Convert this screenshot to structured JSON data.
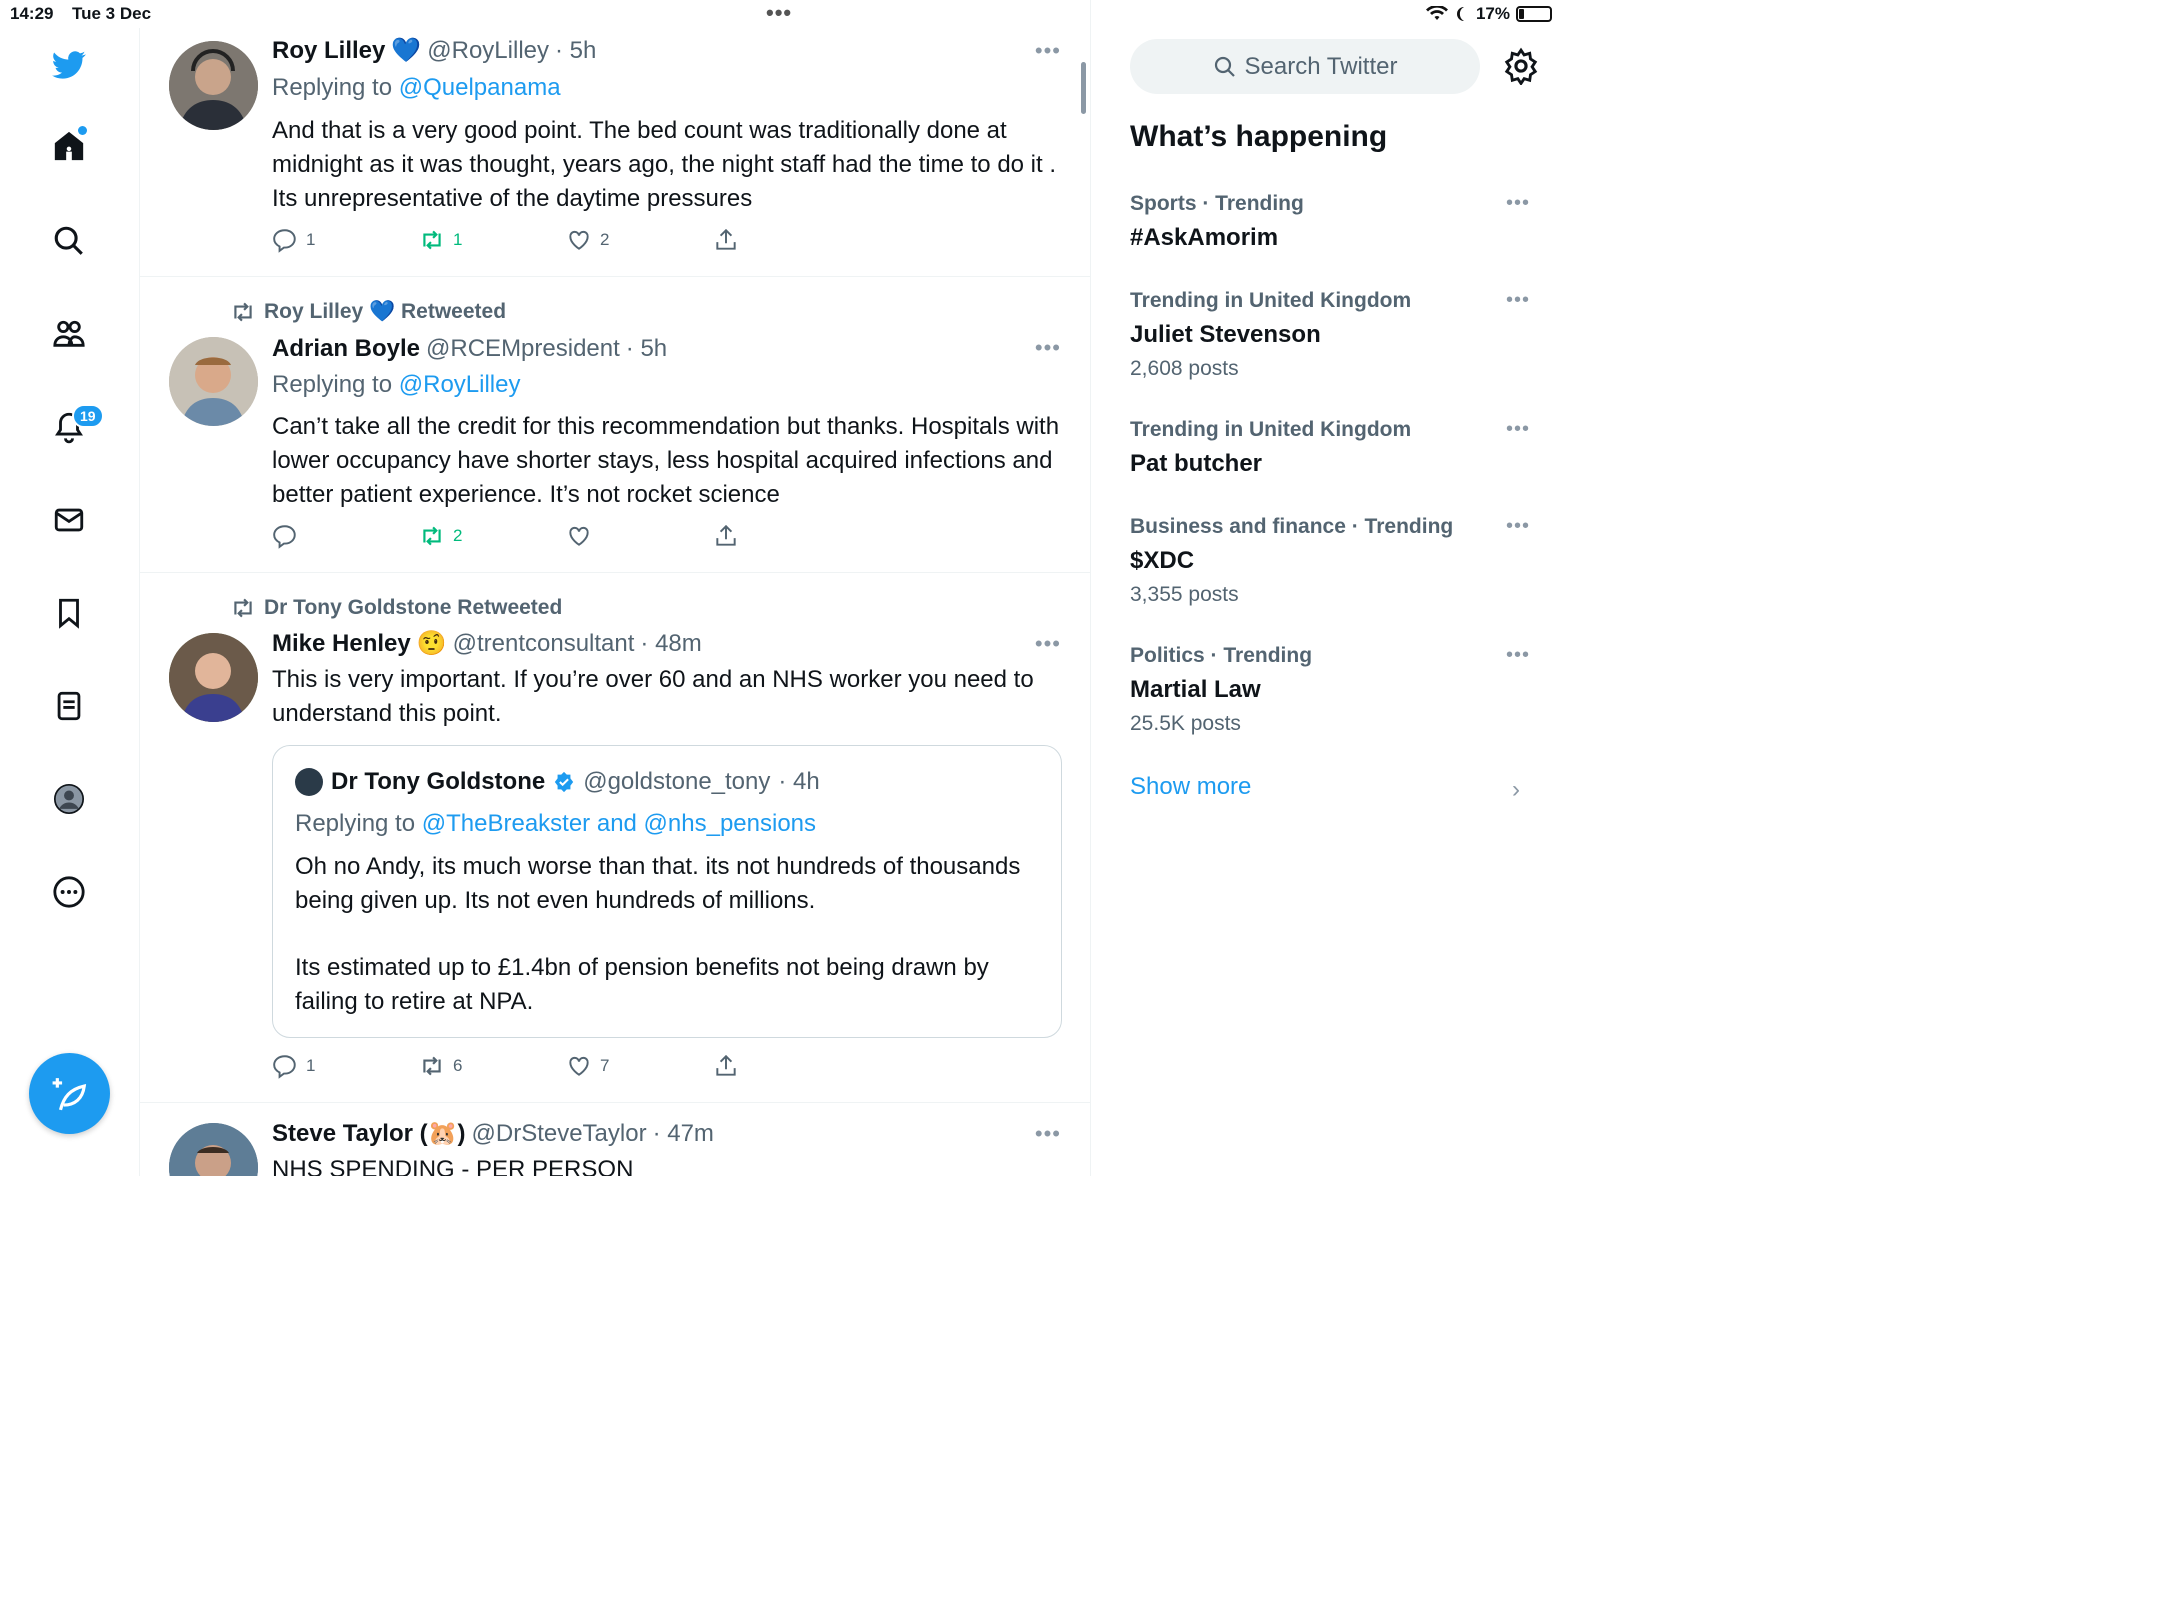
{
  "status_bar": {
    "time": "14:29",
    "date": "Tue 3 Dec",
    "battery": "17%",
    "battery_level": 0.17
  },
  "sidebar": {
    "notifications_count": "19"
  },
  "tweets": [
    {
      "name": "Roy Lilley",
      "emoji": "💙",
      "handle": "@RoyLilley",
      "time": "· 5h",
      "reply_prefix": "Replying to",
      "reply_to": "@Quelpanama",
      "body": "And that is a very good point. The bed count was traditionally done at midnight as it was thought, years ago, the night staff had the time to do it . Its unrepresentative of the daytime pressures",
      "replies": "1",
      "retweets": "1",
      "likes": "2"
    },
    {
      "retweeted_by": "Roy Lilley 💙 Retweeted",
      "name": "Adrian Boyle",
      "handle": "@RCEMpresident",
      "time": "· 5h",
      "reply_prefix": "Replying to",
      "reply_to": "@RoyLilley",
      "body": "Can’t take all the credit for this recommendation but thanks. Hospitals with lower occupancy have shorter stays, less hospital acquired infections and better patient experience. It’s not rocket science",
      "replies": "",
      "retweets": "2",
      "likes": ""
    },
    {
      "retweeted_by": "Dr Tony Goldstone Retweeted",
      "name": "Mike Henley",
      "emoji": "🤨",
      "handle": "@trentconsultant",
      "time": "· 48m",
      "body": "This is very important. If you’re over 60 and an NHS worker you need to understand this point.",
      "quote": {
        "name": "Dr Tony Goldstone",
        "handle": "@goldstone_tony",
        "time": "· 4h",
        "reply_prefix": "Replying to",
        "reply_to": "@TheBreakster and @nhs_pensions",
        "body_1": "Oh no Andy, its much worse than that. its not hundreds of thousands being given up. Its not even hundreds of millions.",
        "body_2": "Its estimated up to £1.4bn of pension benefits not being drawn by failing to retire at NPA."
      },
      "replies": "1",
      "retweets": "6",
      "likes": "7"
    },
    {
      "name": "Steve Taylor (🐹)",
      "handle": "@DrSteveTaylor",
      "time": "· 47m",
      "body": "NHS SPENDING - PER PERSON"
    }
  ],
  "right": {
    "search_placeholder": "Search Twitter",
    "title": "What’s happening",
    "trends": [
      {
        "category": "Sports · Trending",
        "name": "#AskAmorim",
        "count": ""
      },
      {
        "category": "Trending in United Kingdom",
        "name": "Juliet Stevenson",
        "count": "2,608 posts"
      },
      {
        "category": "Trending in United Kingdom",
        "name": "Pat butcher",
        "count": ""
      },
      {
        "category": "Business and finance · Trending",
        "name": "$XDC",
        "count": "3,355 posts"
      },
      {
        "category": "Politics · Trending",
        "name": "Martial Law",
        "count": "25.5K posts"
      }
    ],
    "show_more": "Show more"
  },
  "colors": {
    "accent": "#1d9bf0",
    "retweet_green": "#00ba7c",
    "muted": "#536471"
  }
}
